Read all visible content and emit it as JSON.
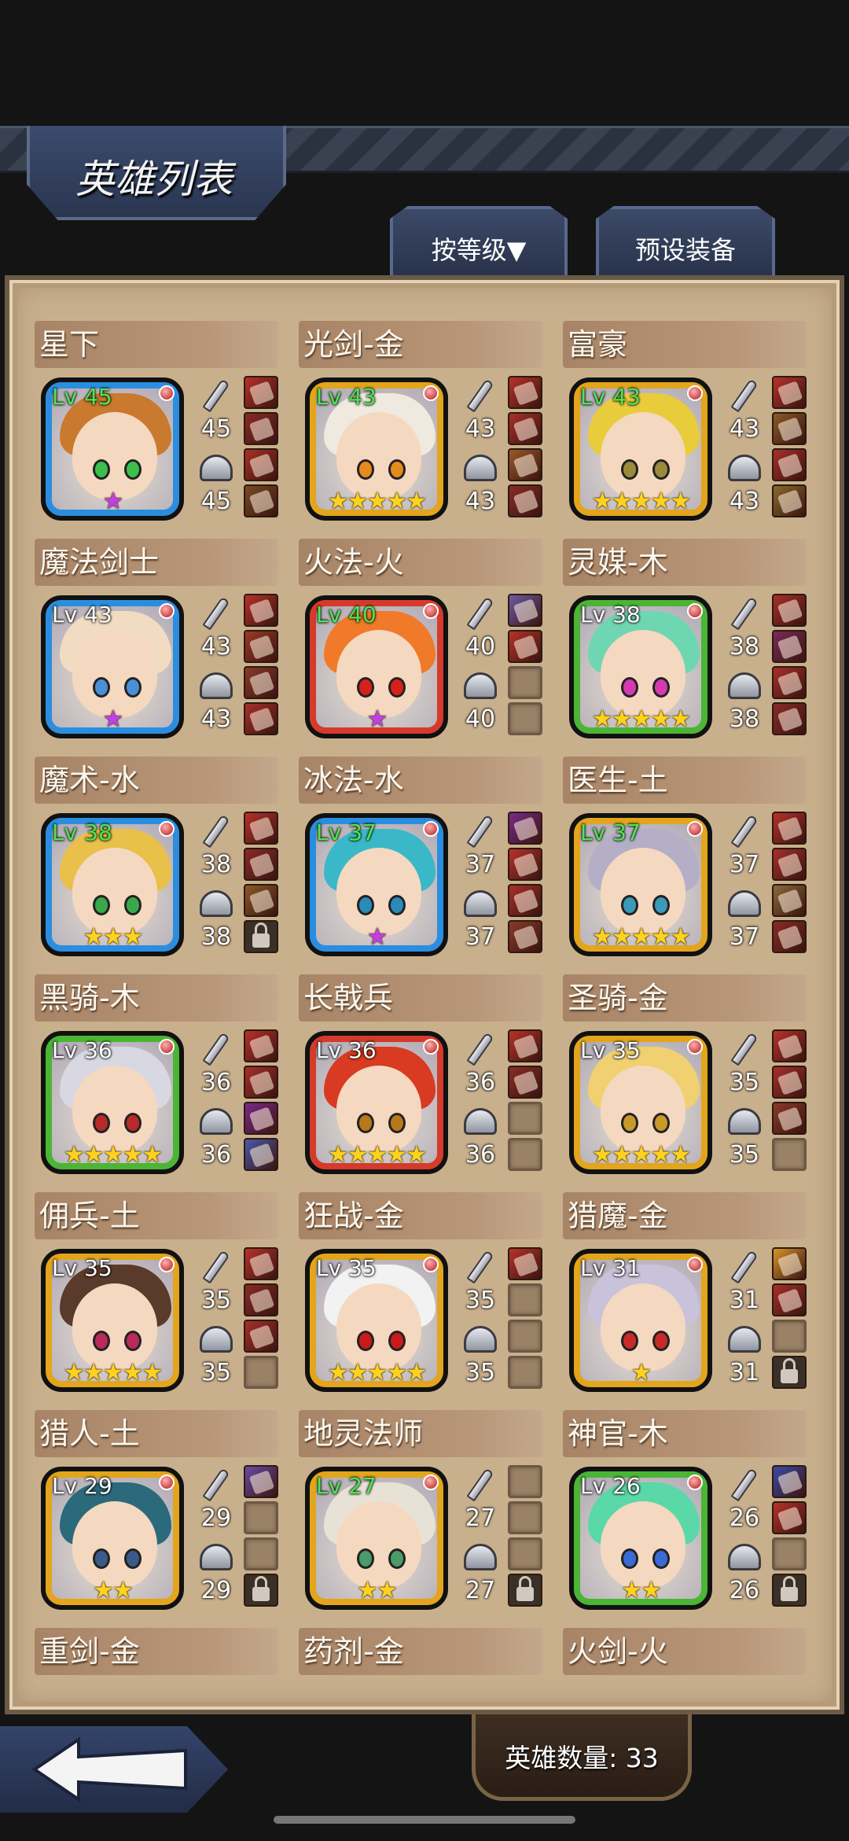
{
  "title": "英雄列表",
  "tabs": {
    "sort_label": "按等级▼",
    "preset_label": "预设装备"
  },
  "footer": {
    "hero_count_label": "英雄数量: 33"
  },
  "colors": {
    "frame_blue": "#2a8ee0",
    "frame_gold": "#e2a51b",
    "frame_red": "#d63a2a",
    "frame_green": "#4bb534",
    "level_green": "#4de84d",
    "star_gold": "#ffd21c",
    "star_purple": "#c23ee6"
  },
  "heroes": [
    {
      "name": "星下",
      "level": "Lv 45",
      "level_color": "green",
      "frame": "blue",
      "hair": "#c97a2e",
      "eye": "#3cbf4c",
      "stars": "★",
      "star_color": "purple",
      "attack": "45",
      "defense": "45",
      "slots": [
        "#b8322a",
        "#8a2b26",
        "#a83224",
        "#7a4a22"
      ]
    },
    {
      "name": "光剑-金",
      "level": "Lv 43",
      "level_color": "green",
      "frame": "gold",
      "hair": "#efe9df",
      "eye": "#e68a1e",
      "stars": "★★★★★",
      "star_color": "gold",
      "attack": "43",
      "defense": "43",
      "slots": [
        "#b8322a",
        "#a8302a",
        "#9a5a2a",
        "#8a2b26"
      ]
    },
    {
      "name": "富豪",
      "level": "Lv 43",
      "level_color": "green",
      "frame": "gold",
      "hair": "#e8cc3c",
      "eye": "#9a8a3a",
      "stars": "★★★★★",
      "star_color": "gold",
      "attack": "43",
      "defense": "43",
      "slots": [
        "#b8322a",
        "#8a5a2a",
        "#a8302a",
        "#8a6a2a"
      ]
    },
    {
      "name": "魔法剑士",
      "level": "Lv 43",
      "level_color": "white",
      "frame": "blue",
      "hair": "#f1dcc2",
      "eye": "#4a8fd8",
      "stars": "★",
      "star_color": "purple",
      "attack": "43",
      "defense": "43",
      "slots": [
        "#b8322a",
        "#9a3a2a",
        "#8a3a2a",
        "#a8302a"
      ]
    },
    {
      "name": "火法-火",
      "level": "Lv 40",
      "level_color": "green",
      "frame": "red",
      "hair": "#f07a2a",
      "eye": "#d8201a",
      "stars": "★",
      "star_color": "purple",
      "attack": "40",
      "defense": "40",
      "slots": [
        "#6e5aa8",
        "#b8322a",
        "empty",
        "empty"
      ]
    },
    {
      "name": "灵媒-木",
      "level": "Lv 38",
      "level_color": "white",
      "frame": "green",
      "hair": "#6fd6b2",
      "eye": "#d63ab0",
      "stars": "★★★★★",
      "star_color": "gold",
      "attack": "38",
      "defense": "38",
      "slots": [
        "#a8302a",
        "#7a2a5a",
        "#a8302a",
        "#8a2b26"
      ]
    },
    {
      "name": "魔术-水",
      "level": "Lv 38",
      "level_color": "green",
      "frame": "blue",
      "hair": "#e8c04a",
      "eye": "#3aa84a",
      "stars": "★★★",
      "star_color": "gold",
      "attack": "38",
      "defense": "38",
      "slots": [
        "#b8322a",
        "#8a2b26",
        "#8a5a2a",
        "locked"
      ]
    },
    {
      "name": "冰法-水",
      "level": "Lv 37",
      "level_color": "green",
      "frame": "blue",
      "hair": "#3bb8c8",
      "eye": "#2a8ab8",
      "stars": "★",
      "star_color": "purple",
      "attack": "37",
      "defense": "37",
      "slots": [
        "#7a2a8a",
        "#b8322a",
        "#a8302a",
        "#8a3a2a"
      ]
    },
    {
      "name": "医生-土",
      "level": "Lv 37",
      "level_color": "green",
      "frame": "gold",
      "hair": "#b4aec6",
      "eye": "#3a9ab8",
      "stars": "★★★★★",
      "star_color": "gold",
      "attack": "37",
      "defense": "37",
      "slots": [
        "#b8322a",
        "#a8302a",
        "#8a6a3a",
        "#8a2b26"
      ]
    },
    {
      "name": "黑骑-木",
      "level": "Lv 36",
      "level_color": "white",
      "frame": "green",
      "hair": "#d8d8e2",
      "eye": "#b82a2a",
      "stars": "★★★★★",
      "star_color": "gold",
      "attack": "36",
      "defense": "36",
      "slots": [
        "#b8322a",
        "#a8302a",
        "#7a2a8a",
        "#4a5aa8"
      ]
    },
    {
      "name": "长戟兵",
      "level": "Lv 36",
      "level_color": "white",
      "frame": "red",
      "hair": "#d83a22",
      "eye": "#b8781a",
      "stars": "★★★★★",
      "star_color": "gold",
      "attack": "36",
      "defense": "36",
      "slots": [
        "#b8322a",
        "#8a2b26",
        "empty",
        "empty"
      ]
    },
    {
      "name": "圣骑-金",
      "level": "Lv 35",
      "level_color": "white",
      "frame": "gold",
      "hair": "#f0d070",
      "eye": "#c89a2a",
      "stars": "★★★★★",
      "star_color": "gold",
      "attack": "35",
      "defense": "35",
      "slots": [
        "#b8322a",
        "#a8302a",
        "#8a3a2a",
        "empty"
      ]
    },
    {
      "name": "佣兵-土",
      "level": "Lv 35",
      "level_color": "white",
      "frame": "gold",
      "hair": "#5a3a2a",
      "eye": "#b82a5a",
      "stars": "★★★★★",
      "star_color": "gold",
      "attack": "35",
      "defense": "35",
      "slots": [
        "#b8322a",
        "#8a2b26",
        "#a8302a",
        "empty"
      ]
    },
    {
      "name": "狂战-金",
      "level": "Lv 35",
      "level_color": "white",
      "frame": "gold",
      "hair": "#f2f2f2",
      "eye": "#c81a1a",
      "stars": "★★★★★",
      "star_color": "gold",
      "attack": "35",
      "defense": "35",
      "slots": [
        "#b8322a",
        "empty",
        "empty",
        "empty"
      ]
    },
    {
      "name": "猎魔-金",
      "level": "Lv 31",
      "level_color": "white",
      "frame": "gold",
      "hair": "#c8c2da",
      "eye": "#c82a2a",
      "stars": "★",
      "star_color": "gold",
      "attack": "31",
      "defense": "31",
      "slots": [
        "#d8962a",
        "#a8302a",
        "empty",
        "locked"
      ]
    },
    {
      "name": "猎人-土",
      "level": "Lv 29",
      "level_color": "white",
      "frame": "gold",
      "hair": "#2a6a7a",
      "eye": "#3a5a8a",
      "stars": "★★",
      "star_color": "gold",
      "attack": "29",
      "defense": "29",
      "slots": [
        "#6a4aa8",
        "empty",
        "empty",
        "locked"
      ]
    },
    {
      "name": "地灵法师",
      "level": "Lv 27",
      "level_color": "green",
      "frame": "gold",
      "hair": "#e8e2d6",
      "eye": "#4a9a6a",
      "stars": "★★",
      "star_color": "gold",
      "attack": "27",
      "defense": "27",
      "slots": [
        "empty",
        "empty",
        "empty",
        "locked"
      ]
    },
    {
      "name": "神官-木",
      "level": "Lv 26",
      "level_color": "white",
      "frame": "green",
      "hair": "#5ad8a8",
      "eye": "#3a6ad8",
      "stars": "★★",
      "star_color": "gold",
      "attack": "26",
      "defense": "26",
      "slots": [
        "#3a4aa8",
        "#b8322a",
        "empty",
        "locked"
      ]
    }
  ],
  "partial_heroes": [
    "重剑-金",
    "药剂-金",
    "火剑-火"
  ]
}
